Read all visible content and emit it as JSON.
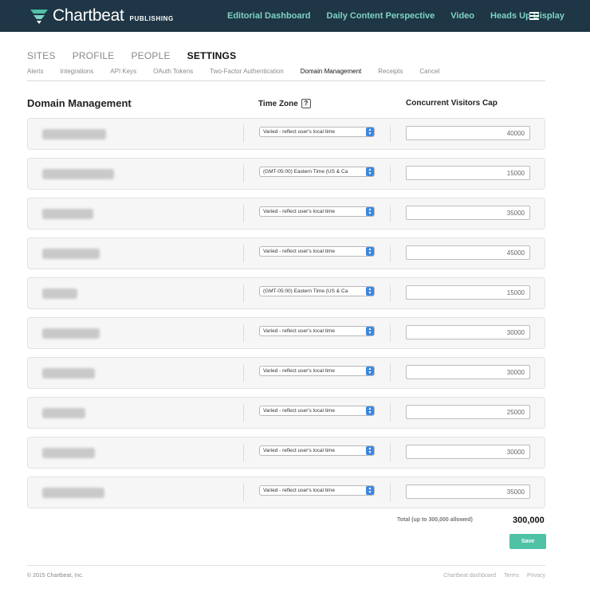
{
  "brand": {
    "name": "Chartbeat",
    "sub": "PUBLISHING"
  },
  "nav": {
    "links": [
      "Editorial Dashboard",
      "Daily Content Perspective",
      "Video",
      "Heads Up Display"
    ]
  },
  "main_tabs": [
    "SITES",
    "PROFILE",
    "PEOPLE",
    "SETTINGS"
  ],
  "active_main_tab": "SETTINGS",
  "sub_tabs": [
    "Alerts",
    "Integrations",
    "API Keys",
    "OAuth Tokens",
    "Two-Factor Authentication",
    "Domain Management",
    "Receipts",
    "Cancel"
  ],
  "active_sub_tab": "Domain Management",
  "table": {
    "domain_header": "Domain Management",
    "timezone_header": "Time Zone",
    "timezone_help": "?",
    "cap_header": "Concurrent Visitors Cap",
    "rows": [
      {
        "timezone": "Varied - reflect user's local time",
        "cap": "40000"
      },
      {
        "timezone": "(GMT-05:00) Eastern Time (US & Ca",
        "cap": "15000"
      },
      {
        "timezone": "Varied - reflect user's local time",
        "cap": "35000"
      },
      {
        "timezone": "Varied - reflect user's local time",
        "cap": "45000"
      },
      {
        "timezone": "(GMT-05:00) Eastern Time (US & Ca",
        "cap": "15000"
      },
      {
        "timezone": "Varied - reflect user's local time",
        "cap": "30000"
      },
      {
        "timezone": "Varied - reflect user's local time",
        "cap": "30000"
      },
      {
        "timezone": "Varied - reflect user's local time",
        "cap": "25000"
      },
      {
        "timezone": "Varied - reflect user's local time",
        "cap": "30000"
      },
      {
        "timezone": "Varied - reflect user's local time",
        "cap": "35000"
      }
    ]
  },
  "totals": {
    "label": "Total (up to 300,000 allowed)",
    "value": "300,000"
  },
  "save_label": "Save",
  "footer": {
    "copyright": "© 2015 Chartbeat, Inc.",
    "links": [
      "Chartbeat dashboard",
      "Terms",
      "Privacy"
    ]
  },
  "colors": {
    "topbar": "#1e3645",
    "nav_link": "#7fd3c3",
    "save_button": "#4fc1a4",
    "select_arrow": "#3b86e0"
  },
  "icons": {
    "logo": "chartbeat-logo-icon",
    "menu": "hamburger-menu-icon",
    "help": "help-icon",
    "select_arrow": "select-arrows-icon"
  }
}
